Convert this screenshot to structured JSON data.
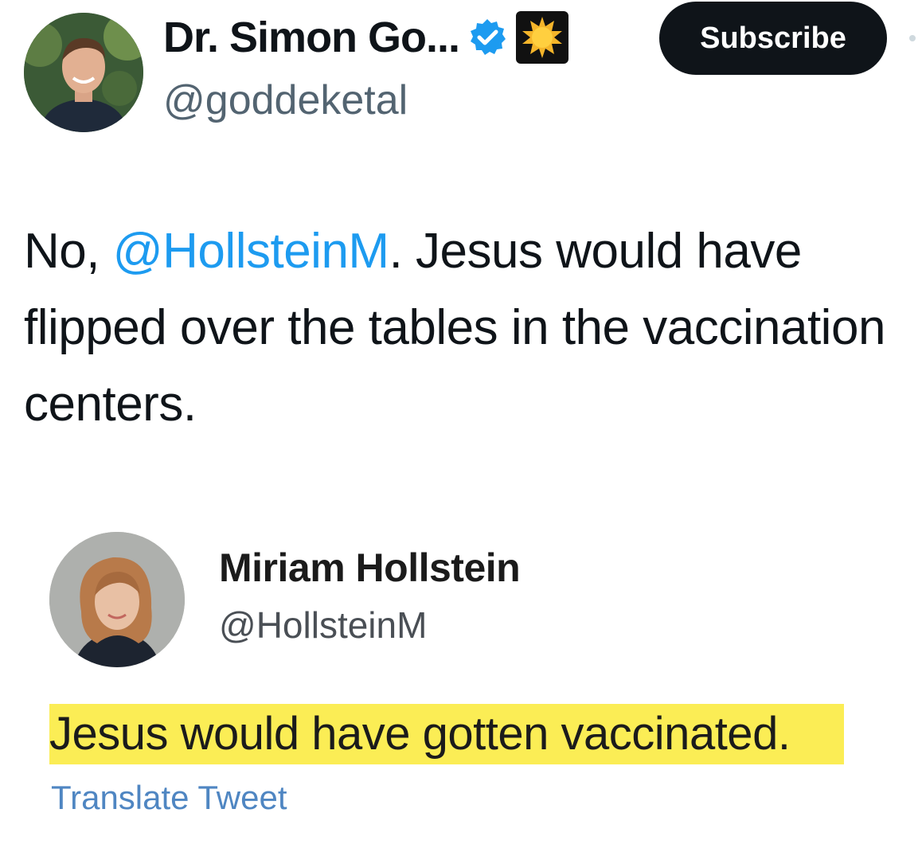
{
  "author": {
    "display_name": "Dr. Simon Go...",
    "handle": "@goddeketal",
    "verified_badge_icon": "verified-check-icon",
    "affiliate_badge_icon": "gold-star-badge-icon"
  },
  "actions": {
    "subscribe_label": "Subscribe",
    "more_icon": "more-dots-icon"
  },
  "tweet": {
    "text_before": "No, ",
    "mention": "@HollsteinM",
    "text_after": ". Jesus would have flipped over the tables in the vaccination centers."
  },
  "quoted": {
    "display_name": "Miriam Hollstein",
    "handle": "@HollsteinM",
    "text": "Jesus would have gotten vaccinated.",
    "translate_label": "Translate Tweet",
    "highlight_color": "#fbed55"
  },
  "colors": {
    "link": "#1d9bf0",
    "text": "#0f1419",
    "secondary": "#536471",
    "button": "#0f1419"
  }
}
